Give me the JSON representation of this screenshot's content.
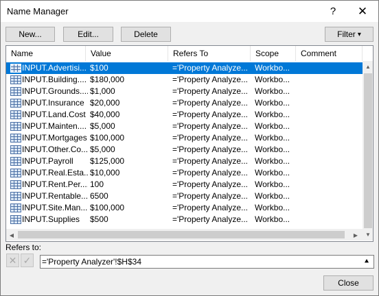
{
  "window": {
    "title": "Name Manager",
    "help": "?",
    "close": "✕"
  },
  "toolbar": {
    "new_label": "New...",
    "edit_label": "Edit...",
    "delete_label": "Delete",
    "filter_label": "Filter",
    "filter_arrow": "▾"
  },
  "columns": {
    "name": "Name",
    "value": "Value",
    "refers_to": "Refers To",
    "scope": "Scope",
    "comment": "Comment"
  },
  "rows": [
    {
      "name": "INPUT.Advertisi...",
      "value": "$100",
      "refers": "='Property Analyze...",
      "scope": "Workbo...",
      "selected": true
    },
    {
      "name": "INPUT.Building....",
      "value": "$180,000",
      "refers": "='Property Analyze...",
      "scope": "Workbo..."
    },
    {
      "name": "INPUT.Grounds....",
      "value": "$1,000",
      "refers": "='Property Analyze...",
      "scope": "Workbo..."
    },
    {
      "name": "INPUT.Insurance",
      "value": "$20,000",
      "refers": "='Property Analyze...",
      "scope": "Workbo..."
    },
    {
      "name": "INPUT.Land.Cost",
      "value": "$40,000",
      "refers": "='Property Analyze...",
      "scope": "Workbo..."
    },
    {
      "name": "INPUT.Mainten....",
      "value": "$5,000",
      "refers": "='Property Analyze...",
      "scope": "Workbo..."
    },
    {
      "name": "INPUT.Mortgages",
      "value": "$100,000",
      "refers": "='Property Analyze...",
      "scope": "Workbo..."
    },
    {
      "name": "INPUT.Other.Co...",
      "value": "$5,000",
      "refers": "='Property Analyze...",
      "scope": "Workbo..."
    },
    {
      "name": "INPUT.Payroll",
      "value": "$125,000",
      "refers": "='Property Analyze...",
      "scope": "Workbo..."
    },
    {
      "name": "INPUT.Real.Esta...",
      "value": "$10,000",
      "refers": "='Property Analyze...",
      "scope": "Workbo..."
    },
    {
      "name": "INPUT.Rent.Per....",
      "value": "100",
      "refers": "='Property Analyze...",
      "scope": "Workbo..."
    },
    {
      "name": "INPUT.Rentable....",
      "value": "6500",
      "refers": "='Property Analyze...",
      "scope": "Workbo..."
    },
    {
      "name": "INPUT.Site.Man...",
      "value": "$100,000",
      "refers": "='Property Analyze...",
      "scope": "Workbo..."
    },
    {
      "name": "INPUT.Supplies",
      "value": "$500",
      "refers": "='Property Analyze...",
      "scope": "Workbo..."
    }
  ],
  "refers_to": {
    "label": "Refers to:",
    "value": "='Property Analyzer'!$H$34",
    "cancel_icon": "✕",
    "confirm_icon": "✓",
    "collapse_icon": "⯅"
  },
  "footer": {
    "close_label": "Close"
  }
}
